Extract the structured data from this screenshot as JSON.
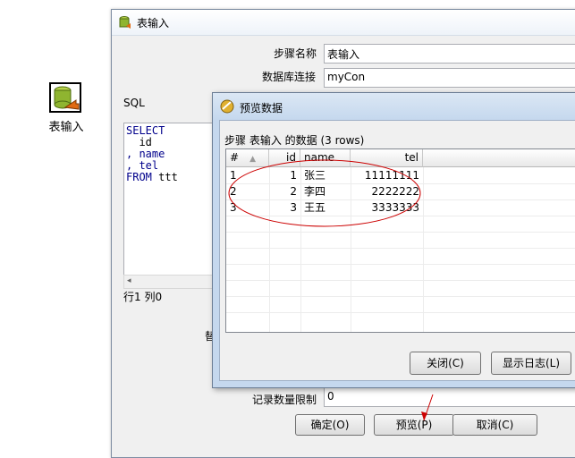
{
  "canvas": {
    "step_label": "表输入"
  },
  "main_dialog": {
    "title": "表输入",
    "step_name_label": "步骤名称",
    "step_name_value": "表输入",
    "db_conn_label": "数据库连接",
    "db_conn_value": "myCon",
    "sql_label": "SQL",
    "sql_lines": [
      {
        "kw": "SELECT",
        "text": ""
      },
      {
        "kw": "",
        "text": "  id"
      },
      {
        "kw": ", name",
        "text": ""
      },
      {
        "kw": "",
        "text": ", tel"
      },
      {
        "kw": "FROM",
        "text": " ttt"
      }
    ],
    "cursor_pos": "行1 列0",
    "partial_label": "替",
    "limit_label": "记录数量限制",
    "limit_value": "0",
    "ok_button": "确定(O)",
    "preview_button": "预览(P)",
    "cancel_button": "取消(C)"
  },
  "preview_dialog": {
    "title": "预览数据",
    "subtitle": "步骤 表输入 的数据  (3 rows)",
    "columns": [
      "#",
      "id",
      "name",
      "tel"
    ],
    "rows": [
      [
        "1",
        "1",
        "张三",
        "11111111"
      ],
      [
        "2",
        "2",
        "李四",
        "2222222"
      ],
      [
        "3",
        "3",
        "王五",
        "3333333"
      ]
    ],
    "close_button": "关闭(C)",
    "show_log_button": "显示日志(L)"
  },
  "colors": {
    "annotation_red": "#cc0000",
    "sql_keyword": "#00008b"
  }
}
